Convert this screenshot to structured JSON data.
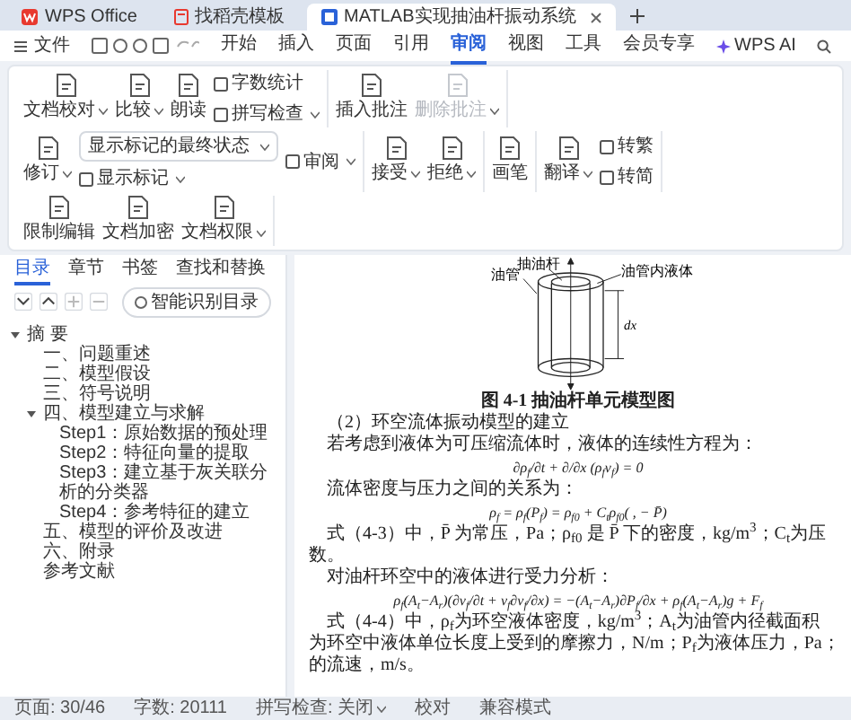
{
  "tabs": [
    {
      "label": "WPS Office",
      "selected": false,
      "kind": "home"
    },
    {
      "label": "找稻壳模板",
      "selected": false,
      "kind": "template"
    },
    {
      "label": "MATLAB实现抽油杆振动系统",
      "selected": true,
      "kind": "doc"
    }
  ],
  "menu": {
    "file": "文件",
    "items": [
      {
        "label": "开始",
        "selected": false
      },
      {
        "label": "插入",
        "selected": false
      },
      {
        "label": "页面",
        "selected": false
      },
      {
        "label": "引用",
        "selected": false
      },
      {
        "label": "审阅",
        "selected": true
      },
      {
        "label": "视图",
        "selected": false
      },
      {
        "label": "工具",
        "selected": false
      },
      {
        "label": "会员专享",
        "selected": false
      }
    ],
    "ai": "WPS AI"
  },
  "ribbon": {
    "groups": [
      [
        [
          {
            "label": "文档校对",
            "kind": "large",
            "dropdown": true,
            "disabled": false
          }
        ],
        [
          {
            "label": "比较",
            "kind": "large",
            "dropdown": true,
            "disabled": false
          }
        ],
        [
          {
            "label": "朗读",
            "kind": "large",
            "dropdown": false,
            "disabled": false
          }
        ],
        [
          {
            "label": "字数统计",
            "kind": "small",
            "dropdown": false,
            "disabled": false
          },
          {
            "label": "拼写检查",
            "kind": "small",
            "dropdown": true,
            "disabled": false
          }
        ]
      ],
      [
        [
          {
            "label": "插入批注",
            "kind": "large",
            "dropdown": false,
            "disabled": false
          }
        ],
        [
          {
            "label": "删除批注",
            "kind": "large",
            "dropdown": true,
            "disabled": true
          }
        ]
      ],
      [
        [
          {
            "label": "修订",
            "kind": "large",
            "dropdown": true,
            "disabled": false
          }
        ],
        [
          {
            "label": "显示标记的最终状态",
            "kind": "select",
            "dropdown": true,
            "disabled": false
          },
          {
            "label": "显示标记",
            "kind": "small",
            "dropdown": true,
            "disabled": false
          }
        ],
        [
          {
            "label": "审阅",
            "kind": "small",
            "dropdown": true,
            "disabled": false
          }
        ]
      ],
      [
        [
          {
            "label": "接受",
            "kind": "large",
            "dropdown": true,
            "disabled": false
          }
        ],
        [
          {
            "label": "拒绝",
            "kind": "large",
            "dropdown": true,
            "disabled": false
          }
        ]
      ],
      [
        [
          {
            "label": "画笔",
            "kind": "large",
            "dropdown": false,
            "disabled": false
          }
        ]
      ],
      [
        [
          {
            "label": "翻译",
            "kind": "large",
            "dropdown": true,
            "disabled": false
          }
        ],
        [
          {
            "label": "转繁",
            "kind": "small",
            "dropdown": false,
            "disabled": false
          },
          {
            "label": "转简",
            "kind": "small",
            "dropdown": false,
            "disabled": false
          }
        ]
      ],
      [
        [
          {
            "label": "限制编辑",
            "kind": "large",
            "dropdown": false,
            "disabled": false
          }
        ],
        [
          {
            "label": "文档加密",
            "kind": "large",
            "dropdown": false,
            "disabled": false
          }
        ],
        [
          {
            "label": "文档权限",
            "kind": "large",
            "dropdown": true,
            "disabled": false
          }
        ]
      ]
    ]
  },
  "sidebar": {
    "tabs": [
      {
        "label": "目录",
        "selected": true
      },
      {
        "label": "章节",
        "selected": false
      },
      {
        "label": "书签",
        "selected": false
      },
      {
        "label": "查找和替换",
        "selected": false
      }
    ],
    "smart_toc_button": "智能识别目录",
    "toc": [
      {
        "label": "摘 要",
        "expanded": true,
        "children": [
          {
            "label": "一、问题重述"
          },
          {
            "label": "二、模型假设"
          },
          {
            "label": "三、符号说明"
          },
          {
            "label": "四、模型建立与求解",
            "expanded": true,
            "children": [
              {
                "label": "Step1：原始数据的预处理"
              },
              {
                "label": "Step2：特征向量的提取"
              },
              {
                "label": "Step3：建立基于灰关联分析的分类器"
              },
              {
                "label": "Step4：参考特征的建立"
              }
            ]
          },
          {
            "label": "五、模型的评价及改进"
          },
          {
            "label": "六、附录"
          },
          {
            "label": "参考文献"
          }
        ]
      }
    ]
  },
  "document": {
    "figure": {
      "rod_label": "抽油杆",
      "tube_label": "油管",
      "fluid_label": "油管内液体",
      "length_label": "dx",
      "caption": "图 4-1 抽油杆单元模型图"
    },
    "blocks": [
      {
        "kind": "para",
        "lines": [
          "（2）环空流体振动模型的建立"
        ]
      },
      {
        "kind": "para",
        "lines": [
          "若考虑到液体为可压缩流体时，液体的连续性方程为："
        ]
      },
      {
        "kind": "equation",
        "text": "∂ρ$_{f}$/∂t + ∂/∂x (ρ$_{f}$v$_{f}$) = 0"
      },
      {
        "kind": "para",
        "lines": [
          "流体密度与压力之间的关系为："
        ]
      },
      {
        "kind": "equation",
        "text": "ρ$_{f}$ = ρ$_{f}$(P$_{f}$) = ρ$_{f0}$ + C$_{t}$ρ$_{f0}$( , − P̄)"
      },
      {
        "kind": "para",
        "lines": [
          "式（4-3）中，P̄ 为常压，Pa；ρ$_{f0}$ 是 P̄ 下的密度，kg/m$^{3}$；C$_{t}$为压",
          "数。"
        ]
      },
      {
        "kind": "para",
        "lines": [
          "对油杆环空中的液体进行受力分析："
        ]
      },
      {
        "kind": "equation",
        "text": "ρ$_{f}$(A$_{t}$−A$_{r}$)(∂v$_{f}$/∂t + v$_{f}$∂v$_{f}$/∂x) = −(A$_{t}$−A$_{r}$)∂P$_{f}$/∂x + ρ$_{f}$(A$_{t}$−A$_{r}$)g + F$_{f}$"
      },
      {
        "kind": "para",
        "lines": [
          "式（4-4）中，ρ$_{f}$为环空液体密度，kg/m$^{3}$；A$_{t}$为油管内径截面积",
          "为环空中液体单位长度上受到的摩擦力，N/m；P$_{f}$为液体压力，Pa；",
          "的流速，m/s。"
        ]
      }
    ]
  },
  "status_bar": [
    {
      "label": "页面: 30/46",
      "dropdown": false
    },
    {
      "label": "字数: 20111",
      "dropdown": false
    },
    {
      "label": "拼写检查: 关闭",
      "dropdown": true
    },
    {
      "label": "校对",
      "dropdown": false
    },
    {
      "label": "兼容模式",
      "dropdown": false
    }
  ]
}
